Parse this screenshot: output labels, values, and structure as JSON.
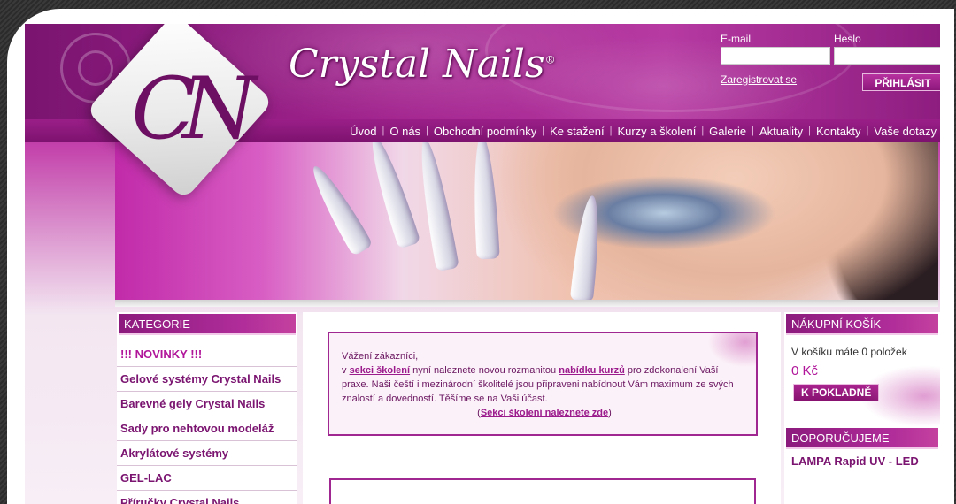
{
  "header": {
    "brand_name": "Crystal Nails",
    "brand_mark": "®",
    "logo_letters": "CN",
    "email_label": "E-mail",
    "password_label": "Heslo",
    "register_link": "Zaregistrovat se",
    "login_button": "PŘIHLÁSIT"
  },
  "nav": {
    "items": [
      {
        "label": "Úvod"
      },
      {
        "label": "O nás"
      },
      {
        "label": "Obchodní podmínky"
      },
      {
        "label": "Ke stažení"
      },
      {
        "label": "Kurzy a školení"
      },
      {
        "label": "Galerie"
      },
      {
        "label": "Aktuality"
      },
      {
        "label": "Kontakty"
      },
      {
        "label": "Vaše dotazy"
      }
    ],
    "separator": "|"
  },
  "categories": {
    "title": "KATEGORIE",
    "items": [
      {
        "label": "!!! NOVINKY !!!"
      },
      {
        "label": "Gelové systémy Crystal Nails"
      },
      {
        "label": "Barevné gely Crystal Nails"
      },
      {
        "label": "Sady pro nehtovou modeláž"
      },
      {
        "label": "Akrylátové systémy"
      },
      {
        "label": "GEL-LAC"
      },
      {
        "label": "Příručky Crystal Nails"
      }
    ]
  },
  "notice": {
    "greeting": "Vážení zákazníci,",
    "line1_pre": "v ",
    "link1": "sekci školení",
    "line1_mid": " nyní naleznete novou rozmanitou ",
    "link2": "nabídku kurzů",
    "line1_post": " pro zdokonalení Vaší praxe. Naši čeští i mezinárodní školitelé jsou připraveni nabídnout Vám maximum ze svých znalostí a dovedností. Těšíme se na Vaši účast.",
    "footer_open": "(",
    "footer_link": "Sekci školení naleznete zde",
    "footer_close": ")"
  },
  "cart": {
    "title": "NÁKUPNÍ KOŠÍK",
    "status": "V košíku máte 0 položek",
    "total": "0 Kč",
    "checkout_button": "K POKLADNĚ"
  },
  "recommend": {
    "title": "DOPORUČUJEME",
    "items": [
      {
        "label": "LAMPA Rapid UV - LED"
      }
    ]
  },
  "colors": {
    "brand_purple": "#8d1b7d",
    "accent_magenta": "#b0159a",
    "background_frame": "#ffffff"
  }
}
